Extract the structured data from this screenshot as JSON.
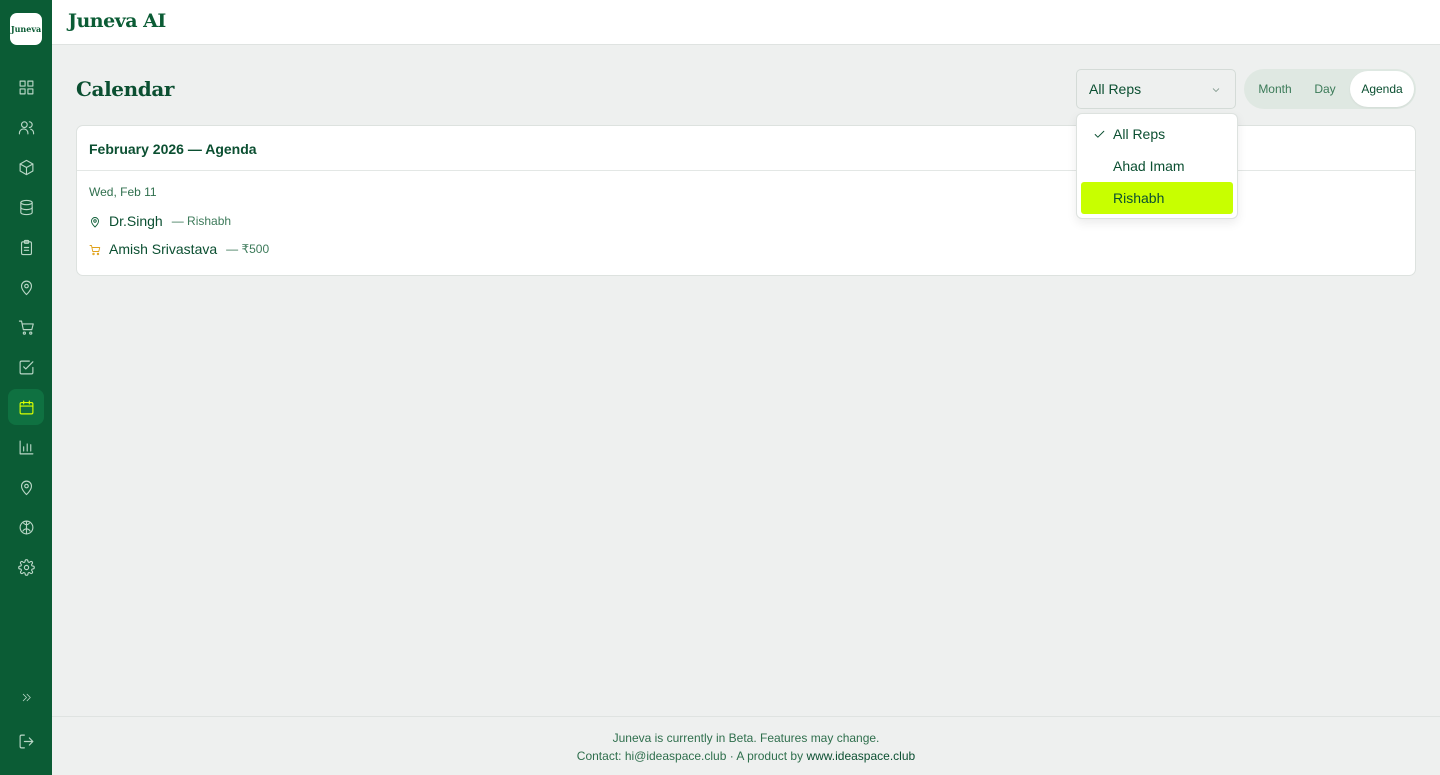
{
  "app": {
    "logo_text": "Juneva",
    "brand": "Juneva AI"
  },
  "sidebar": {
    "items": [
      {
        "name": "dashboard",
        "icon": "grid-icon",
        "active": false
      },
      {
        "name": "users",
        "icon": "users-icon",
        "active": false
      },
      {
        "name": "products",
        "icon": "box-icon",
        "active": false
      },
      {
        "name": "database",
        "icon": "database-icon",
        "active": false
      },
      {
        "name": "tasks",
        "icon": "clipboard-icon",
        "active": false
      },
      {
        "name": "locations",
        "icon": "map-pin-icon",
        "active": false
      },
      {
        "name": "orders",
        "icon": "cart-icon",
        "active": false
      },
      {
        "name": "checklist",
        "icon": "check-square-icon",
        "active": false
      },
      {
        "name": "calendar",
        "icon": "calendar-icon",
        "active": true
      },
      {
        "name": "reports",
        "icon": "bar-chart-icon",
        "active": false
      },
      {
        "name": "map",
        "icon": "map-pin-icon",
        "active": false
      },
      {
        "name": "ai",
        "icon": "brain-icon",
        "active": false
      },
      {
        "name": "settings",
        "icon": "gear-icon",
        "active": false
      }
    ],
    "expand_icon": "chevrons-right-icon",
    "logout_icon": "logout-icon"
  },
  "page": {
    "title": "Calendar"
  },
  "rep_filter": {
    "selected": "All Reps",
    "options": [
      {
        "label": "All Reps",
        "checked": true,
        "highlighted": false
      },
      {
        "label": "Ahad Imam",
        "checked": false,
        "highlighted": false
      },
      {
        "label": "Rishabh",
        "checked": false,
        "highlighted": true
      }
    ]
  },
  "view_toggle": {
    "options": [
      "Month",
      "Day",
      "Agenda"
    ],
    "active": "Agenda"
  },
  "agenda": {
    "heading": "February 2026 — Agenda",
    "day_label": "Wed, Feb 11",
    "events": [
      {
        "icon": "map-pin-icon",
        "icon_color": "#0b5c35",
        "title": "Dr.Singh",
        "meta": "— Rishabh"
      },
      {
        "icon": "cart-icon",
        "icon_color": "#e0a21c",
        "title": "Amish Srivastava",
        "meta": "— ₹500"
      }
    ]
  },
  "footer": {
    "line1": "Juneva is currently in Beta. Features may change.",
    "line2_prefix": "Contact: hi@ideaspace.club · A product by ",
    "line2_link": "www.ideaspace.club"
  },
  "colors": {
    "sidebar_bg": "#0b5c35",
    "accent_highlight": "#c8ff00",
    "active_icon": "#d9ff00",
    "text_primary": "#0b4f31"
  }
}
